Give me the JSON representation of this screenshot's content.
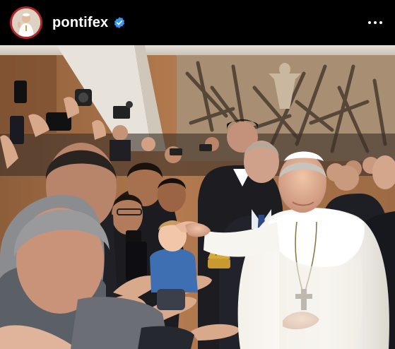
{
  "post": {
    "username": "pontifex",
    "verified": true,
    "avatar_icon": "pope-portrait-avatar",
    "menu_icon": "more-options-icon"
  },
  "colors": {
    "header_background": "#000000",
    "avatar_ring": "#b0262b",
    "verified_blue": "#3897f0",
    "text": "#ffffff"
  }
}
